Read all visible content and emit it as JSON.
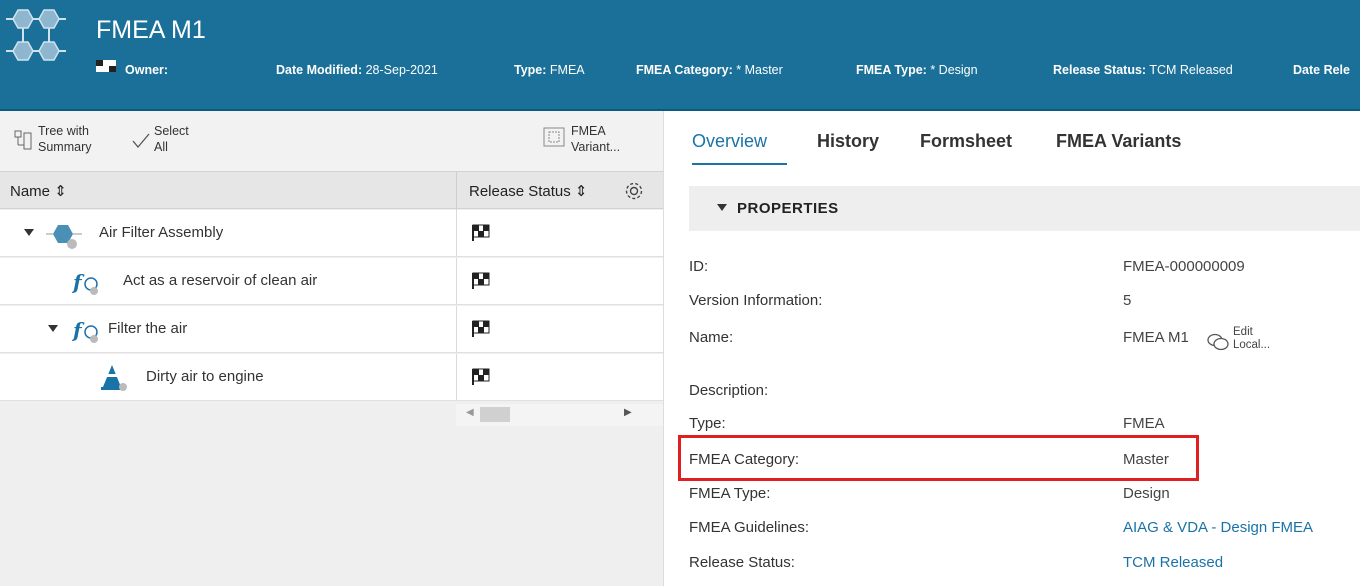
{
  "header": {
    "title": "FMEA M1",
    "owner_label": "Owner:",
    "date_modified_label": "Date Modified:",
    "date_modified_value": "28-Sep-2021",
    "type_label": "Type:",
    "type_value": "FMEA",
    "fmea_category_label": "FMEA Category:",
    "fmea_category_value": "* Master",
    "fmea_type_label": "FMEA Type:",
    "fmea_type_value": "* Design",
    "release_status_label": "Release Status:",
    "release_status_value": "TCM Released",
    "date_released_label": "Date Rele"
  },
  "toolbar": {
    "tree_label_1": "Tree with",
    "tree_label_2": "Summary",
    "select_label_1": "Select",
    "select_label_2": "All",
    "variants_label_1": "FMEA",
    "variants_label_2": "Variant..."
  },
  "grid": {
    "col_name": "Name",
    "col_release": "Release Status",
    "rows": [
      {
        "label": "Air Filter Assembly"
      },
      {
        "label": "Act as a reservoir of clean air"
      },
      {
        "label": "Filter the air"
      },
      {
        "label": "Dirty air to engine"
      }
    ]
  },
  "tabs": [
    "Overview",
    "History",
    "Formsheet",
    "FMEA Variants"
  ],
  "properties": {
    "section_title": "PROPERTIES",
    "edit_local_1": "Edit",
    "edit_local_2": "Local...",
    "items": [
      {
        "label": "ID:",
        "value": "FMEA-000000009"
      },
      {
        "label": "Version Information:",
        "value": "5"
      },
      {
        "label": "Name:",
        "value": "FMEA M1"
      },
      {
        "label": "Description:",
        "value": ""
      },
      {
        "label": "Type:",
        "value": "FMEA"
      },
      {
        "label": "FMEA Category:",
        "value": "Master"
      },
      {
        "label": "FMEA Type:",
        "value": "Design"
      },
      {
        "label": "FMEA Guidelines:",
        "value": "AIAG & VDA - Design FMEA"
      },
      {
        "label": "Release Status:",
        "value": "TCM Released"
      }
    ]
  },
  "colors": {
    "header_bg": "#1a7099",
    "accent": "#1a73a8",
    "highlight_box": "#e02020"
  }
}
